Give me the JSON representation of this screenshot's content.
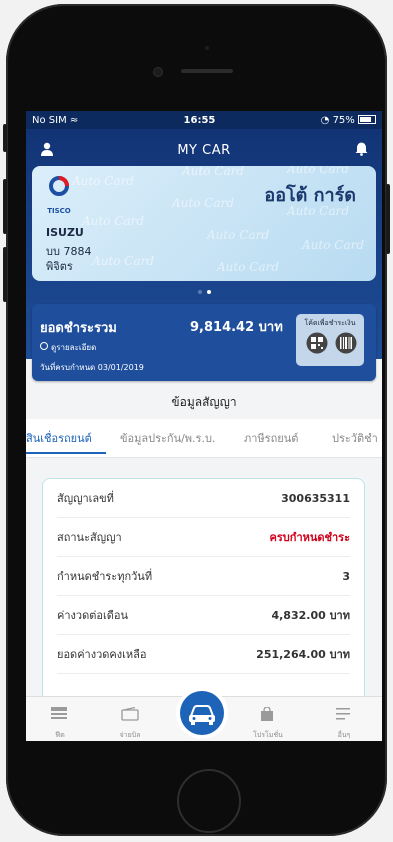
{
  "status_bar": {
    "carrier": "No SIM",
    "time": "16:55",
    "battery": "75%"
  },
  "nav": {
    "title": "MY CAR"
  },
  "card": {
    "brand": "ออโต้ การ์ด",
    "logo_text": "TISCO",
    "watermark": "Auto Card",
    "make": "ISUZU",
    "plate": "บบ 7884",
    "province": "พิจิตร"
  },
  "summary": {
    "label": "ยอดชำระรวม",
    "amount": "9,814.42 บาท",
    "detail_link": "ดูรายละเอียด",
    "due_date": "วันที่ครบกำหนด 03/01/2019",
    "paycode_label": "โค้ดเพื่อชำระเงิน"
  },
  "section_title": "ข้อมูลสัญญา",
  "tabs": [
    "สินเชื่อรถยนต์",
    "ข้อมูลประกัน/พ.ร.บ.",
    "ภาษีรถยนต์",
    "ประวัติชำ"
  ],
  "contract": [
    {
      "label": "สัญญาเลขที่",
      "value": "300635311"
    },
    {
      "label": "สถานะสัญญา",
      "value": "ครบกำหนดชำระ"
    },
    {
      "label": "กำหนดชำระทุกวันที่",
      "value": "3"
    },
    {
      "label": "ค่างวดต่อเดือน",
      "value": "4,832.00 บาท"
    },
    {
      "label": "ยอดค่างวดคงเหลือ",
      "value": "251,264.00 บาท"
    }
  ],
  "bottom_nav": [
    "ฟีด",
    "จ่ายบิล",
    "โปรโมชั่น",
    "อื่นๆ"
  ],
  "colors": {
    "primary": "#1d63b8",
    "header": "#123476",
    "alert": "#d0021b"
  }
}
